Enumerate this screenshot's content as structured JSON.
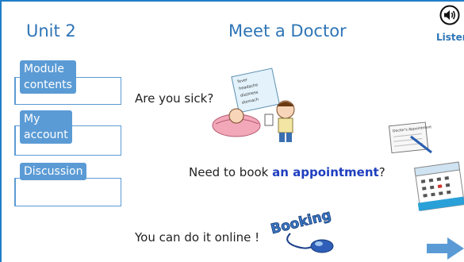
{
  "header": {
    "unit": "Unit 2",
    "title": "Meet a Doctor",
    "listen_label": "Listen"
  },
  "sidebar": {
    "items": [
      {
        "line1": "Module",
        "line2": "contents"
      },
      {
        "line1": "My",
        "line2": "account"
      },
      {
        "line1": "Discussion",
        "line2": ""
      }
    ]
  },
  "content": {
    "q1": "Are you sick?",
    "q2_before": "Need to book ",
    "q2_highlight": "an appointment",
    "q2_after": "?",
    "q3": "You can do it online !",
    "booking_text": "Booking",
    "doctor_appointment_text": "Doctor's Appointment",
    "symptoms": [
      "fever",
      "headache",
      "dizziness",
      "stomach"
    ]
  },
  "colors": {
    "accent": "#2e75b6",
    "nav_fill": "#5b9bd5",
    "highlight": "#1f3fbf"
  },
  "icons": {
    "listen": "speaker-icon",
    "next": "arrow-right-icon"
  }
}
